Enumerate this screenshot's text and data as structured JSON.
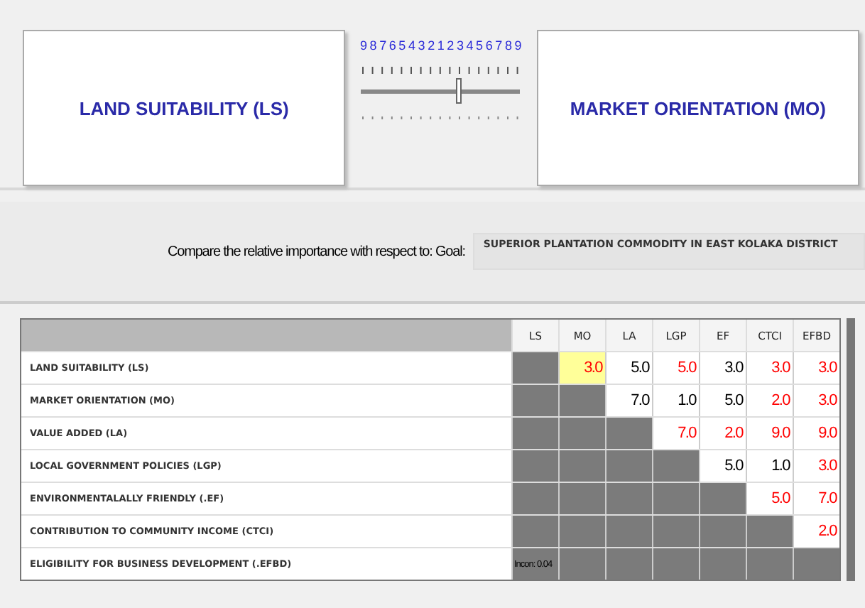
{
  "left_panel": {
    "title": "LAND SUITABILITY (LS)"
  },
  "right_panel": {
    "title": "MARKET ORIENTATION (MO)"
  },
  "slider": {
    "scale": [
      "9",
      "8",
      "7",
      "6",
      "5",
      "4",
      "3",
      "2",
      "1",
      "2",
      "3",
      "4",
      "5",
      "6",
      "7",
      "8",
      "9"
    ],
    "level": 0.62
  },
  "goal": {
    "label": "Compare the relative importance with respect to: Goal:",
    "value": "SUPERIOR PLANTATION COMMODITY IN EAST KOLAKA DISTRICT"
  },
  "table": {
    "columns": [
      "LS",
      "MO",
      "LA",
      "LGP",
      "EF",
      "CTCI",
      "EFBD"
    ],
    "rows": [
      {
        "label": "LAND SUITABILITY (LS)",
        "cells": [
          {
            "kind": "blank"
          },
          {
            "kind": "value",
            "text": "3.0",
            "color": "#ff0000",
            "selected": true
          },
          {
            "kind": "value",
            "text": "5.0",
            "color": "#000000",
            "selected": false
          },
          {
            "kind": "value",
            "text": "5.0",
            "color": "#ff0000",
            "selected": false
          },
          {
            "kind": "value",
            "text": "3.0",
            "color": "#000000",
            "selected": false
          },
          {
            "kind": "value",
            "text": "3.0",
            "color": "#ff0000",
            "selected": false
          },
          {
            "kind": "value",
            "text": "3.0",
            "color": "#ff0000",
            "selected": false
          }
        ]
      },
      {
        "label": "MARKET ORIENTATION (MO)",
        "cells": [
          {
            "kind": "blank"
          },
          {
            "kind": "blank"
          },
          {
            "kind": "value",
            "text": "7.0",
            "color": "#000000",
            "selected": false
          },
          {
            "kind": "value",
            "text": "1.0",
            "color": "#000000",
            "selected": false
          },
          {
            "kind": "value",
            "text": "5.0",
            "color": "#000000",
            "selected": false
          },
          {
            "kind": "value",
            "text": "2.0",
            "color": "#ff0000",
            "selected": false
          },
          {
            "kind": "value",
            "text": "3.0",
            "color": "#ff0000",
            "selected": false
          }
        ]
      },
      {
        "label": "VALUE ADDED (LA)",
        "cells": [
          {
            "kind": "blank"
          },
          {
            "kind": "blank"
          },
          {
            "kind": "blank"
          },
          {
            "kind": "value",
            "text": "7.0",
            "color": "#ff0000",
            "selected": false
          },
          {
            "kind": "value",
            "text": "2.0",
            "color": "#ff0000",
            "selected": false
          },
          {
            "kind": "value",
            "text": "9.0",
            "color": "#ff0000",
            "selected": false
          },
          {
            "kind": "value",
            "text": "9.0",
            "color": "#ff0000",
            "selected": false
          }
        ]
      },
      {
        "label": "LOCAL GOVERNMENT POLICIES (LGP)",
        "cells": [
          {
            "kind": "blank"
          },
          {
            "kind": "blank"
          },
          {
            "kind": "blank"
          },
          {
            "kind": "blank"
          },
          {
            "kind": "value",
            "text": "5.0",
            "color": "#000000",
            "selected": false
          },
          {
            "kind": "value",
            "text": "1.0",
            "color": "#000000",
            "selected": false
          },
          {
            "kind": "value",
            "text": "3.0",
            "color": "#ff0000",
            "selected": false
          }
        ]
      },
      {
        "label": "ENVIRONMENTALALLY FRIENDLY (.EF)",
        "cells": [
          {
            "kind": "blank"
          },
          {
            "kind": "blank"
          },
          {
            "kind": "blank"
          },
          {
            "kind": "blank"
          },
          {
            "kind": "blank"
          },
          {
            "kind": "value",
            "text": "5.0",
            "color": "#ff0000",
            "selected": false
          },
          {
            "kind": "value",
            "text": "7.0",
            "color": "#ff0000",
            "selected": false
          }
        ]
      },
      {
        "label": "CONTRIBUTION TO COMMUNITY INCOME (CTCI)",
        "cells": [
          {
            "kind": "blank"
          },
          {
            "kind": "blank"
          },
          {
            "kind": "blank"
          },
          {
            "kind": "blank"
          },
          {
            "kind": "blank"
          },
          {
            "kind": "blank"
          },
          {
            "kind": "value",
            "text": "2.0",
            "color": "#ff0000",
            "selected": false
          }
        ]
      },
      {
        "label": "ELIGIBILITY FOR BUSINESS DEVELOPMENT (.EFBD)",
        "cells": [
          {
            "kind": "note",
            "text": "Incon: 0.04"
          },
          {
            "kind": "blank"
          },
          {
            "kind": "blank"
          },
          {
            "kind": "blank"
          },
          {
            "kind": "blank"
          },
          {
            "kind": "blank"
          },
          {
            "kind": "blank"
          }
        ]
      }
    ]
  }
}
